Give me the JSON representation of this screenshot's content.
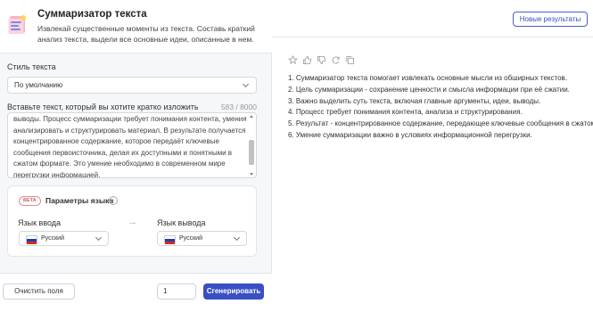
{
  "tool": {
    "title": "Суммаризатор текста",
    "description": "Извлекай существенные моменты из текста. Составь краткий анализ текста, выдели все основные идеи, описанные в нем."
  },
  "style": {
    "label": "Стиль текста",
    "value": "По умолчанию"
  },
  "input": {
    "label": "Вставьте текст, который вы хотите кратко изложить",
    "counter": "583 / 8000",
    "text": "выводы. Процесс суммаризации требует понимания контента, умения анализировать и структурировать материал. В результате получается концентрированное содержание, которое передаёт ключевые сообщения первоисточника, делая их доступными и понятными в сжатом формате. Это умение необходимо в современном мире перегрузки информацией."
  },
  "language": {
    "badge": "BETA",
    "title": "Параметры языка",
    "info_icon": "info-icon",
    "input_label": "Язык ввода",
    "output_label": "Язык вывода",
    "input_value": "Русский",
    "output_value": "Русский",
    "flag_colors": [
      "#ffffff",
      "#1c3fb3",
      "#d52b1e"
    ]
  },
  "footer": {
    "clear_label": "Очистить поля",
    "count_value": "1",
    "generate_label": "Сгенерировать"
  },
  "results": {
    "new_button": "Новые результаты",
    "action_icons": [
      "star-icon",
      "thumbs-up-icon",
      "thumbs-down-icon",
      "refresh-icon",
      "copy-icon"
    ],
    "lines": [
      "1. Суммаризатор текста помогает извлекать основные мысли из обширных текстов.",
      "2. Цель суммаризации - сохранение ценности и смысла информации при её сжатии.",
      "3. Важно выделить суть текста, включая главные аргументы, идеи, выводы.",
      "4. Процесс требует понимания контента, анализа и структурирования.",
      "5. Результат - концентрированное содержание, передающее ключевые сообщения в сжатом формате.",
      "6. Умение суммаризации важно в условиях информационной перегрузки."
    ]
  },
  "colors": {
    "accent": "#3a4fc4",
    "beta": "#d35c5c",
    "panel_bg": "#f6f7f9"
  }
}
